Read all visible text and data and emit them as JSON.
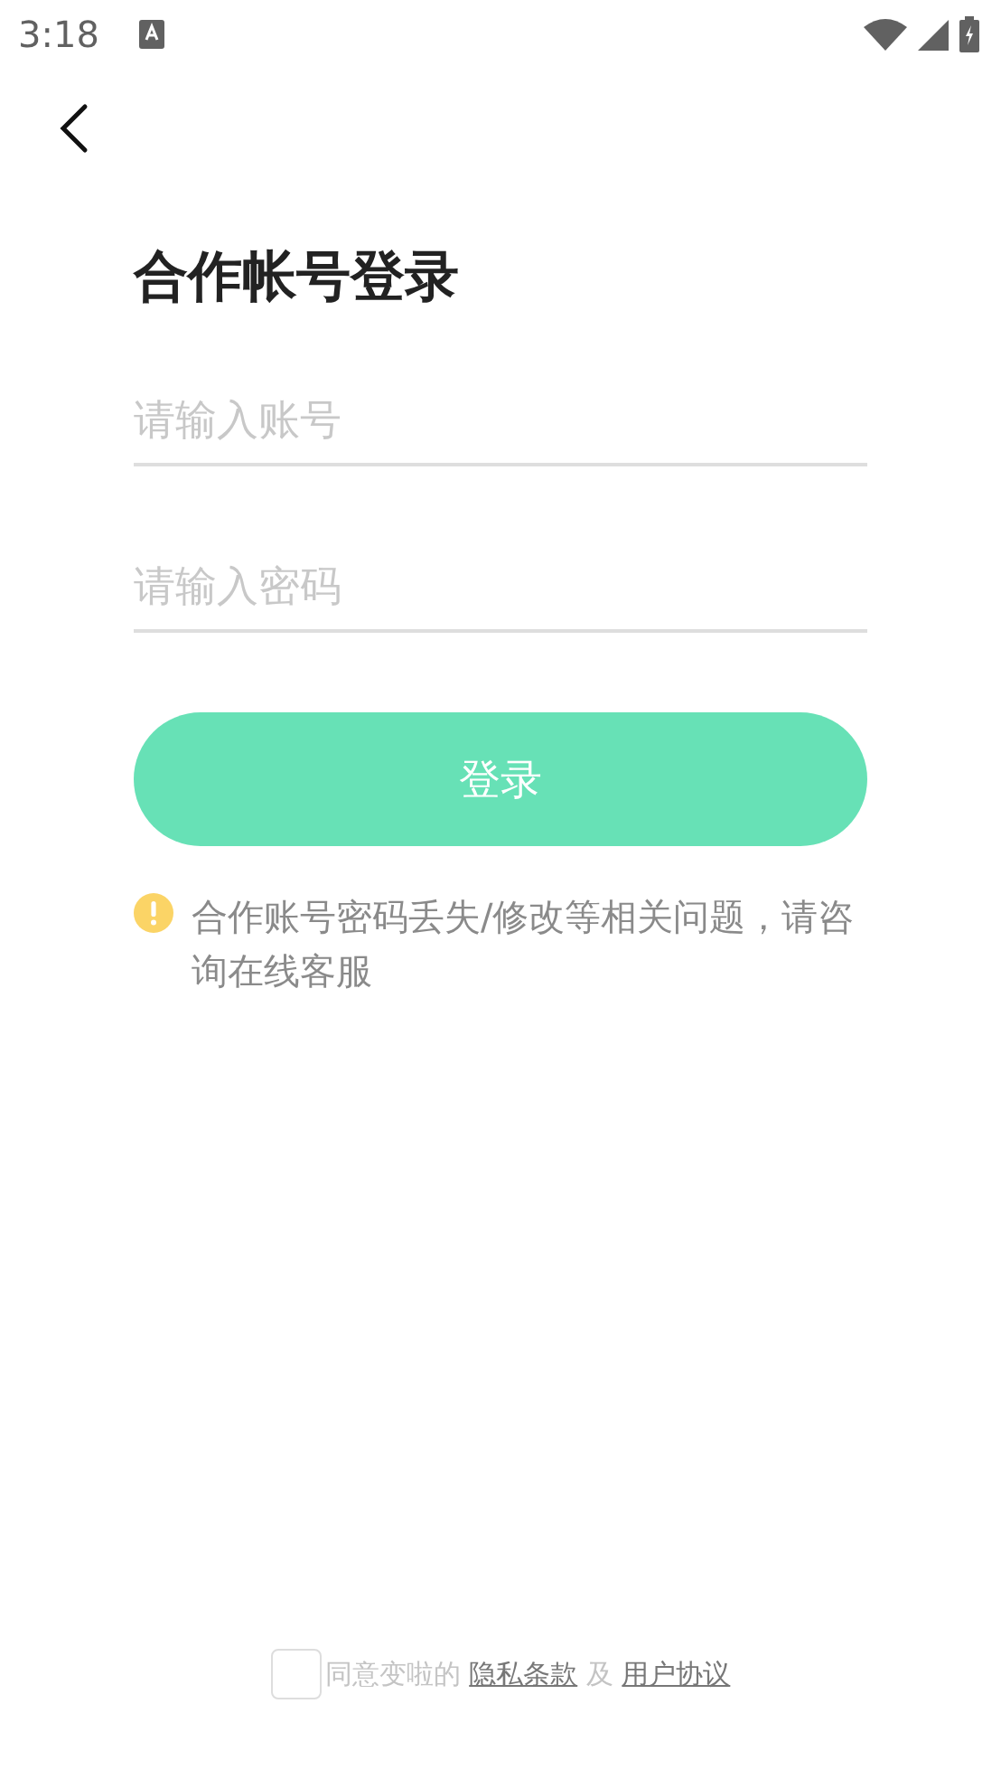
{
  "status_bar": {
    "time": "3:18"
  },
  "title": "合作帐号登录",
  "account_field": {
    "placeholder": "请输入账号"
  },
  "password_field": {
    "placeholder": "请输入密码"
  },
  "login_button": "登录",
  "notice": "合作账号密码丢失/修改等相关问题，请咨询在线客服",
  "agreement": {
    "checked": false,
    "text": "同意变啦的",
    "privacy_link": "隐私条款",
    "joiner": "及",
    "terms_link": "用户协议"
  }
}
